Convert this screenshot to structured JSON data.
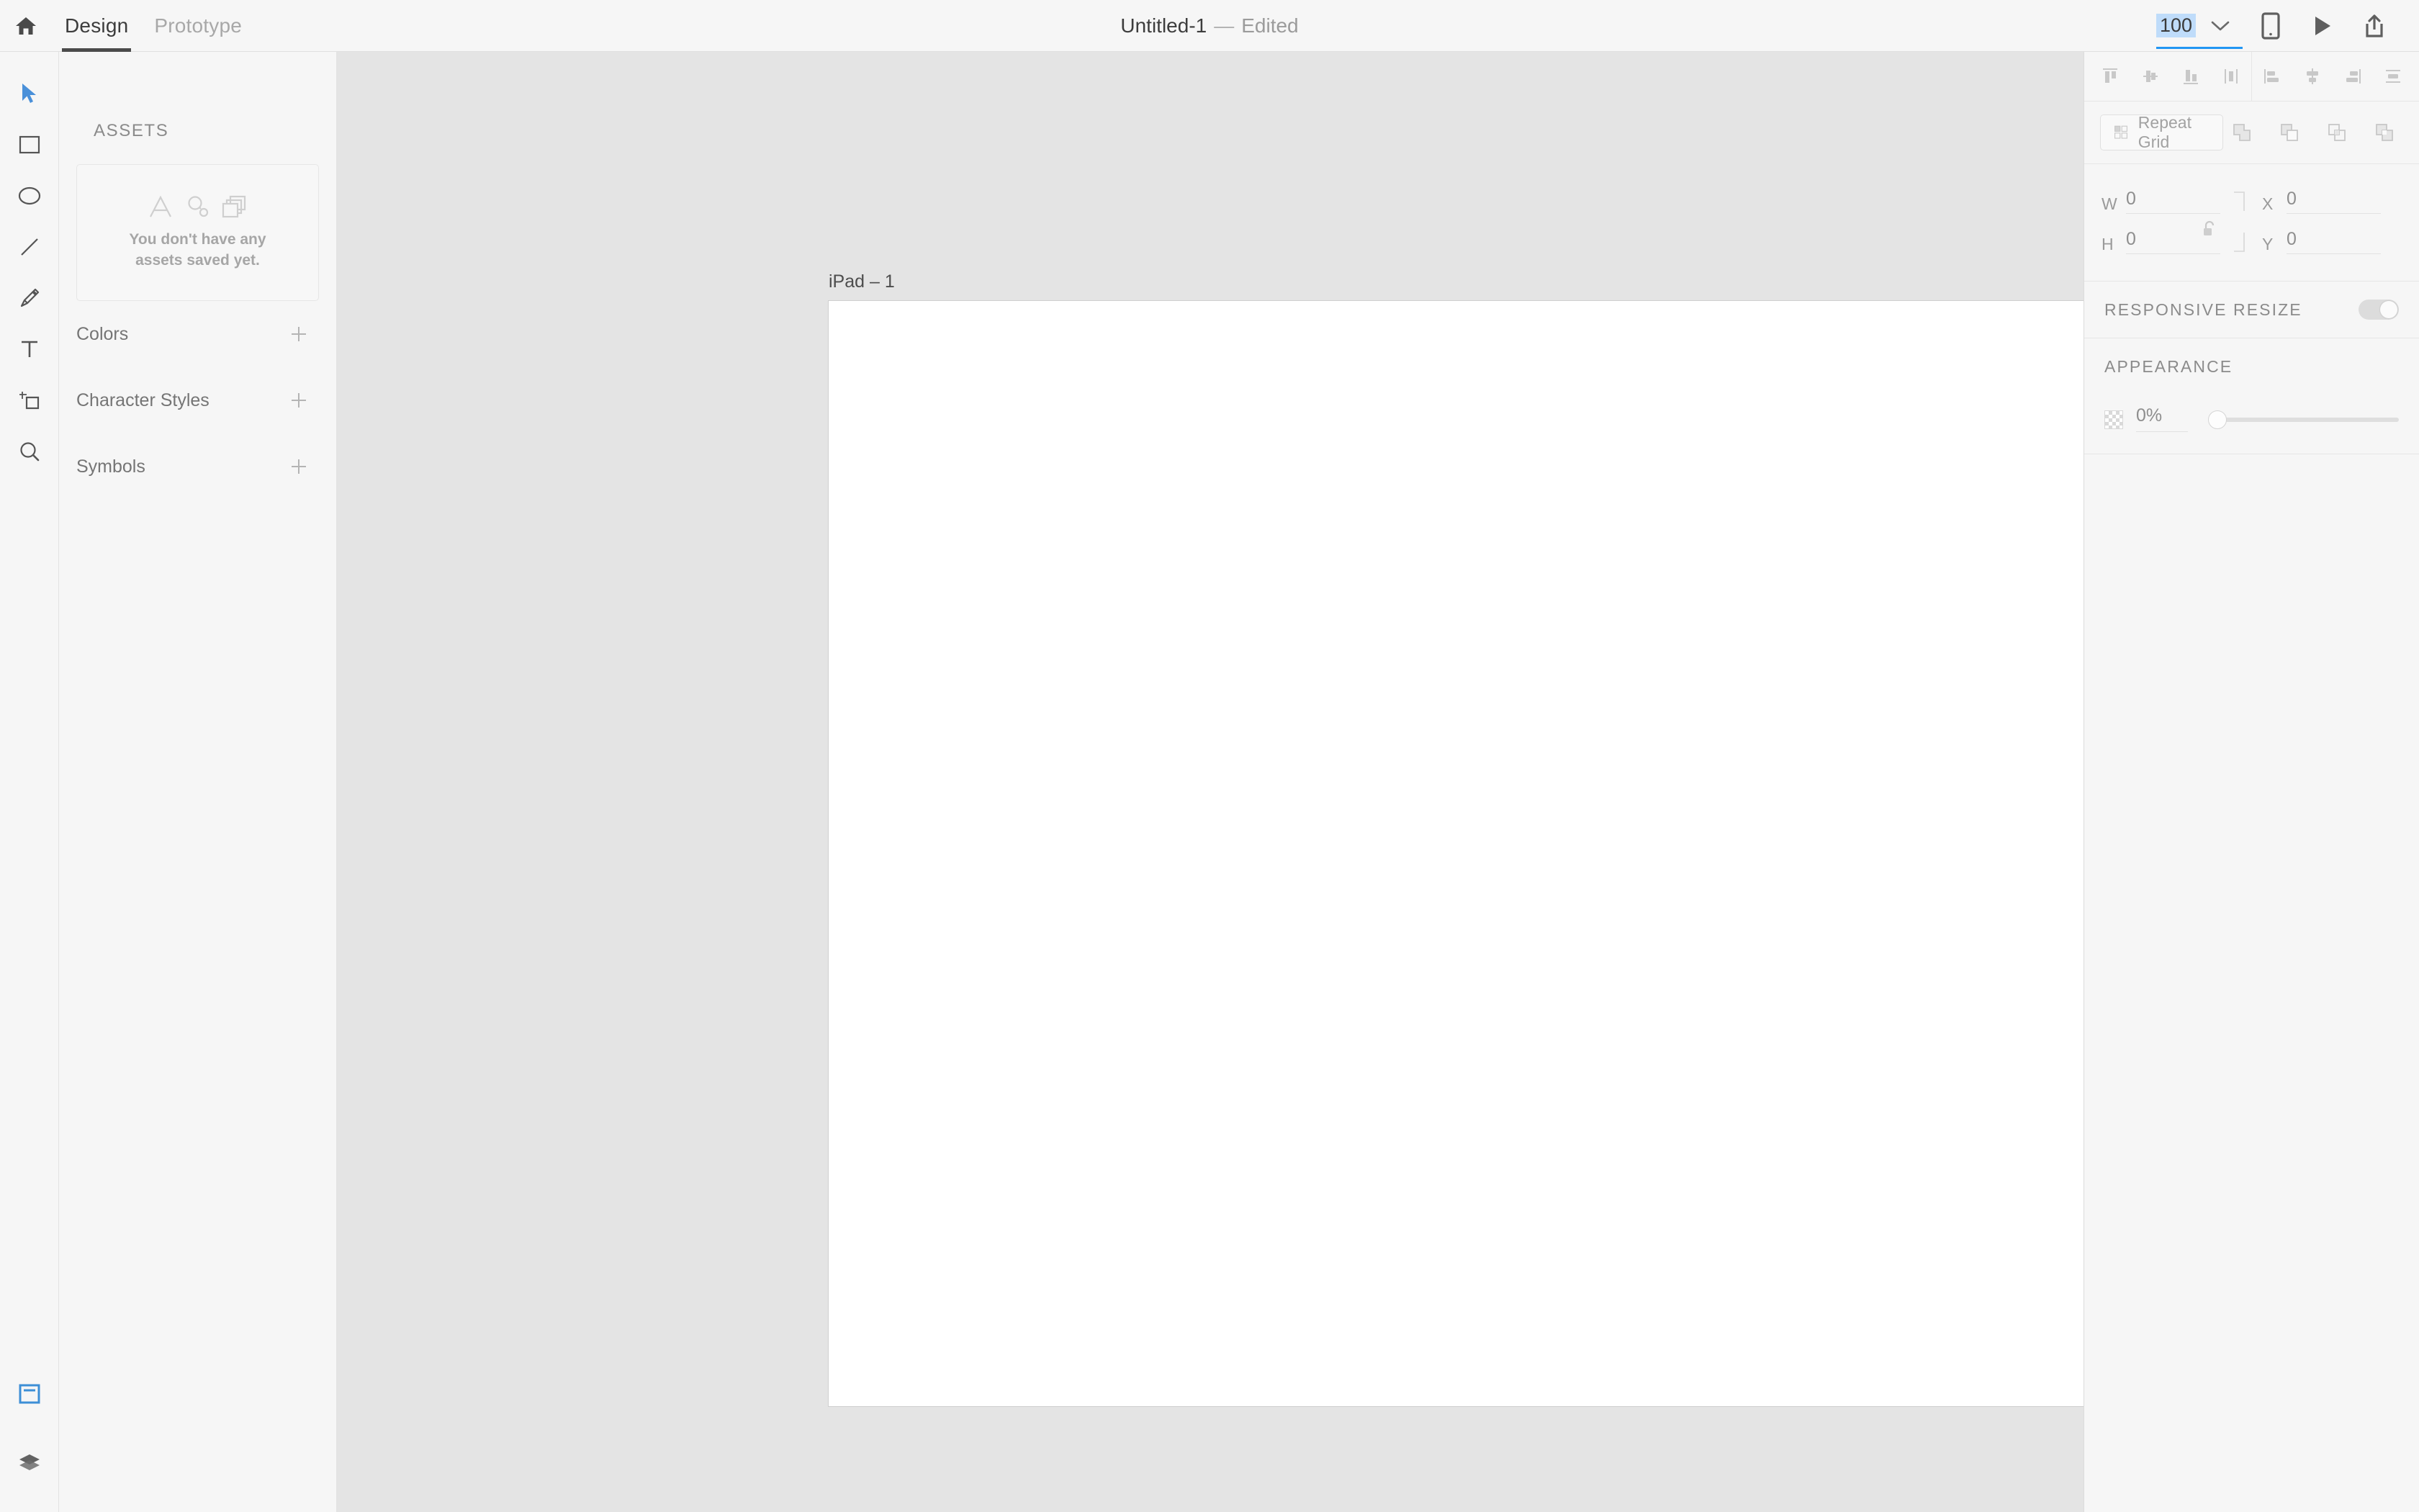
{
  "topbar": {
    "home_icon": "home-icon",
    "tabs": [
      {
        "label": "Design",
        "active": true
      },
      {
        "label": "Prototype",
        "active": false
      }
    ],
    "document": {
      "name": "Untitled-1",
      "separator": "—",
      "state": "Edited"
    },
    "zoom": {
      "value": "100",
      "selected": true,
      "highlight_color": "#bfdcfa",
      "underline_color": "#2196f3",
      "dropdown_icon": "chevron-down-icon"
    },
    "actions": [
      {
        "icon": "device-preview-icon",
        "name": "device-preview-button"
      },
      {
        "icon": "play-icon",
        "name": "desktop-preview-button"
      },
      {
        "icon": "share-icon",
        "name": "share-button"
      }
    ]
  },
  "toolbar": {
    "tools": [
      {
        "name": "select-tool",
        "icon": "cursor-icon",
        "active": true
      },
      {
        "name": "rectangle-tool",
        "icon": "rectangle-icon",
        "active": false
      },
      {
        "name": "ellipse-tool",
        "icon": "ellipse-icon",
        "active": false
      },
      {
        "name": "line-tool",
        "icon": "line-icon",
        "active": false
      },
      {
        "name": "pen-tool",
        "icon": "pen-icon",
        "active": false
      },
      {
        "name": "text-tool",
        "icon": "text-icon",
        "active": false
      },
      {
        "name": "artboard-tool",
        "icon": "artboard-icon",
        "active": false
      },
      {
        "name": "zoom-tool",
        "icon": "magnifier-icon",
        "active": false
      }
    ],
    "bottom_tools": [
      {
        "name": "assets-panel-toggle",
        "icon": "assets-panel-icon",
        "active": true
      },
      {
        "name": "layers-panel-toggle",
        "icon": "layers-icon",
        "active": false
      }
    ],
    "active_color": "#4a90d9"
  },
  "assets": {
    "title": "ASSETS",
    "empty_state": {
      "icons": [
        "character-style-icon",
        "color-swatch-icon",
        "symbol-icon"
      ],
      "line1": "You don't have any",
      "line2": "assets saved yet."
    },
    "sections": [
      {
        "label": "Colors",
        "add_icon": "plus-icon"
      },
      {
        "label": "Character Styles",
        "add_icon": "plus-icon"
      },
      {
        "label": "Symbols",
        "add_icon": "plus-icon"
      }
    ]
  },
  "canvas": {
    "background_color": "#e4e4e4",
    "artboard": {
      "label": "iPad – 1",
      "fill": "#ffffff",
      "border_color": "#cfcfcf"
    }
  },
  "right_panel": {
    "align_group_1": [
      {
        "name": "align-top-button",
        "icon": "align-top-icon"
      },
      {
        "name": "align-middle-button",
        "icon": "align-middle-icon"
      },
      {
        "name": "align-bottom-button",
        "icon": "align-bottom-icon"
      },
      {
        "name": "distribute-horizontal-button",
        "icon": "distribute-horizontal-icon"
      }
    ],
    "align_group_2": [
      {
        "name": "align-left-button",
        "icon": "align-left-icon"
      },
      {
        "name": "align-center-button",
        "icon": "align-center-icon"
      },
      {
        "name": "align-right-button",
        "icon": "align-right-icon"
      },
      {
        "name": "distribute-vertical-button",
        "icon": "distribute-vertical-icon"
      }
    ],
    "repeat_grid": {
      "label": "Repeat Grid",
      "icon": "repeat-grid-icon"
    },
    "boolean_ops": [
      {
        "name": "boolean-add-button",
        "icon": "boolean-union-icon"
      },
      {
        "name": "boolean-subtract-button",
        "icon": "boolean-subtract-icon"
      },
      {
        "name": "boolean-intersect-button",
        "icon": "boolean-intersect-icon"
      },
      {
        "name": "boolean-exclude-button",
        "icon": "boolean-exclude-icon"
      }
    ],
    "dimensions": {
      "w_label": "W",
      "w_value": "0",
      "h_label": "H",
      "h_value": "0",
      "x_label": "X",
      "x_value": "0",
      "y_label": "Y",
      "y_value": "0",
      "lock_icon": "unlocked-icon",
      "lock_state": "unlocked"
    },
    "responsive_resize": {
      "label": "RESPONSIVE RESIZE",
      "enabled": false,
      "toggle_color": "#dcdcdc"
    },
    "appearance": {
      "label": "APPEARANCE",
      "opacity_value": "0%",
      "opacity_percent": 0,
      "swatch_icon": "checkerboard-swatch-icon"
    }
  }
}
